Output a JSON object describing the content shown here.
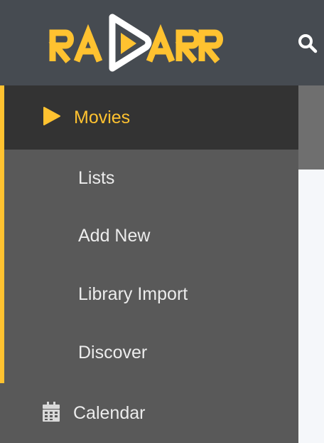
{
  "header": {
    "logo_text": "RADARR",
    "search_icon": "search-icon"
  },
  "sidebar": {
    "active": {
      "label": "Movies",
      "icon": "play-icon"
    },
    "sub_items": [
      {
        "label": "Lists"
      },
      {
        "label": "Add New"
      },
      {
        "label": "Library Import"
      },
      {
        "label": "Discover"
      }
    ],
    "calendar": {
      "label": "Calendar",
      "icon": "calendar-icon"
    }
  },
  "colors": {
    "accent": "#ffc230",
    "header_bg": "#464b51",
    "sidebar_bg": "#595959",
    "active_bg": "#333333"
  }
}
